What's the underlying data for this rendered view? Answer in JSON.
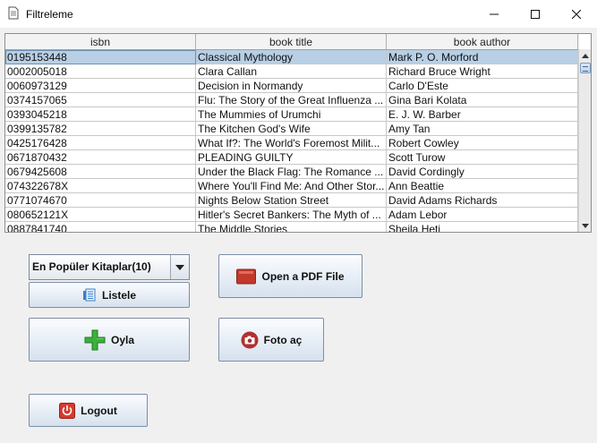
{
  "window": {
    "title": "Filtreleme"
  },
  "table": {
    "columns": [
      "isbn",
      "book title",
      "book author"
    ],
    "rows": [
      [
        "0195153448",
        "Classical Mythology",
        "Mark P. O. Morford"
      ],
      [
        "0002005018",
        "Clara Callan",
        "Richard Bruce Wright"
      ],
      [
        "0060973129",
        "Decision in Normandy",
        "Carlo D'Este"
      ],
      [
        "0374157065",
        "Flu: The Story of the Great Influenza ...",
        "Gina Bari Kolata"
      ],
      [
        "0393045218",
        "The Mummies of Urumchi",
        "E. J. W. Barber"
      ],
      [
        "0399135782",
        "The Kitchen God's Wife",
        "Amy Tan"
      ],
      [
        "0425176428",
        "What If?: The World's Foremost Milit...",
        "Robert Cowley"
      ],
      [
        "0671870432",
        "PLEADING GUILTY",
        "Scott Turow"
      ],
      [
        "0679425608",
        "Under the Black Flag: The Romance ...",
        "David Cordingly"
      ],
      [
        "074322678X",
        "Where You'll Find Me: And Other Stor...",
        "Ann Beattie"
      ],
      [
        "0771074670",
        "Nights Below Station Street",
        "David Adams Richards"
      ],
      [
        "080652121X",
        "Hitler's Secret Bankers: The Myth of ...",
        "Adam Lebor"
      ],
      [
        "0887841740",
        "The Middle Stories",
        "Sheila Heti"
      ]
    ],
    "selected_row": 0
  },
  "controls": {
    "combo_value": "En Popüler Kitaplar(10)",
    "listele_label": "Listele",
    "pdf_label": "Open a PDF File",
    "oyla_label": "Oyla",
    "foto_label": "Foto aç",
    "logout_label": "Logout",
    "pdf_icon_text": "PDF"
  },
  "icons": {
    "app": "document-icon",
    "listele": "list-icon",
    "pdf": "pdf-icon",
    "oyla": "plus-icon",
    "foto": "camera-icon",
    "logout": "power-icon"
  },
  "colors": {
    "selection": "#b8cfe5",
    "plus_green": "#2fa52f",
    "pdf_red": "#c0392b",
    "camera_red": "#b03030",
    "power_red": "#d63a2e"
  }
}
